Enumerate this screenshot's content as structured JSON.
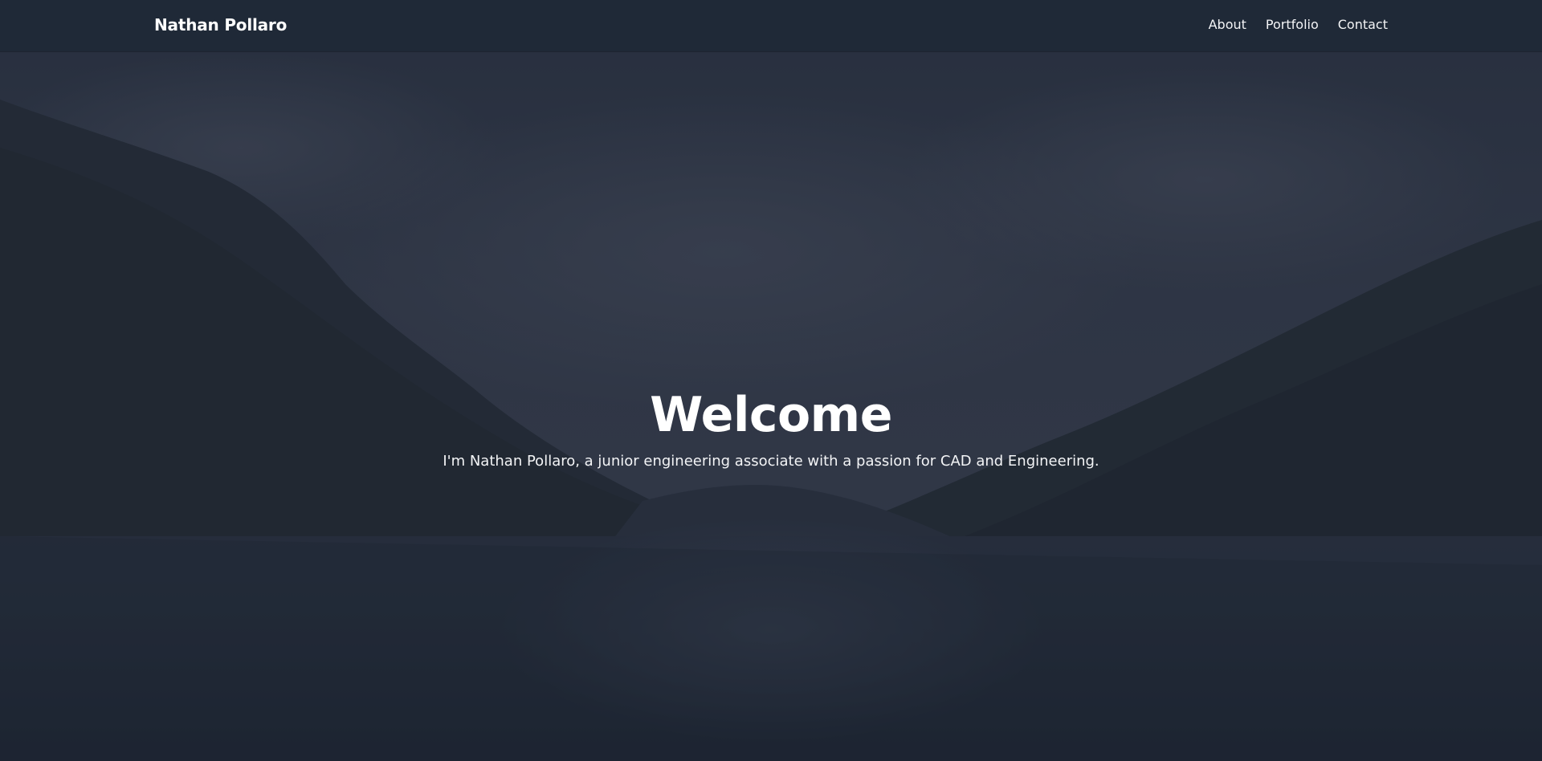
{
  "nav": {
    "brand": "Nathan Pollaro",
    "links": [
      "About",
      "Portfolio",
      "Contact"
    ]
  },
  "hero": {
    "title": "Welcome",
    "subtitle": "I'm Nathan Pollaro, a junior engineering associate with a passion for CAD and Engineering.",
    "background": "mountain-lake-photo"
  },
  "colors": {
    "navbar_bg": "#1f2937",
    "overlay": "#1f2937",
    "text": "#ffffff"
  }
}
